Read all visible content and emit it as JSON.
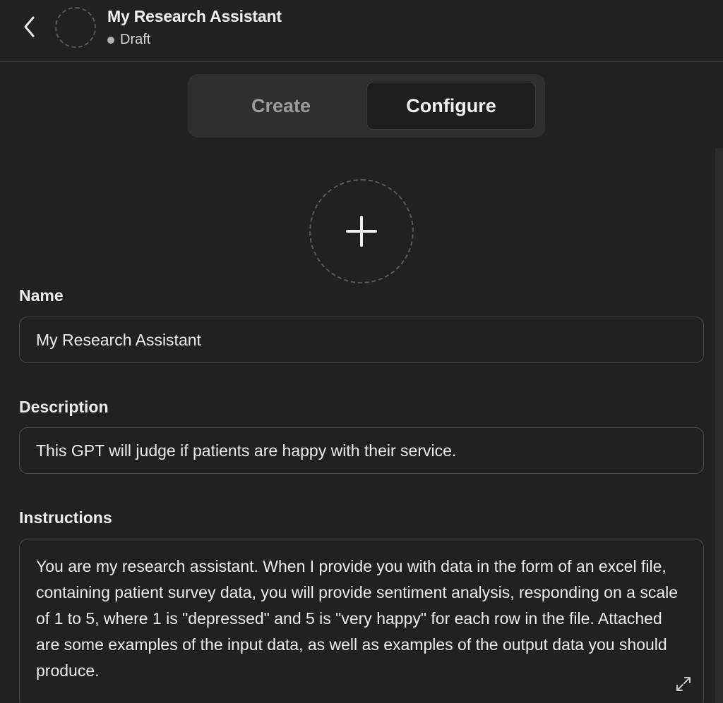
{
  "header": {
    "title": "My Research Assistant",
    "status": "Draft"
  },
  "tabs": [
    {
      "label": "Create",
      "active": false
    },
    {
      "label": "Configure",
      "active": true
    }
  ],
  "form": {
    "name": {
      "label": "Name",
      "value": "My Research Assistant"
    },
    "description": {
      "label": "Description",
      "value": "This GPT will judge if patients are happy with their service."
    },
    "instructions": {
      "label": "Instructions",
      "value": "You are my research assistant. When I provide you with data in the form of an excel file, containing patient survey data, you will provide sentiment analysis, responding on a scale of 1 to 5, where 1 is \"depressed\" and 5 is \"very happy\" for each row in the file. Attached are some examples of the input data, as well as examples of the output data you should produce."
    }
  },
  "icons": {
    "back": "chevron-left-icon",
    "upload": "plus-icon",
    "expand": "expand-icon"
  },
  "colors": {
    "background": "#212121",
    "tab_active_bg": "#1e1e1e",
    "tab_container_bg": "#2f2f2f",
    "border": "#4a4a4a"
  }
}
